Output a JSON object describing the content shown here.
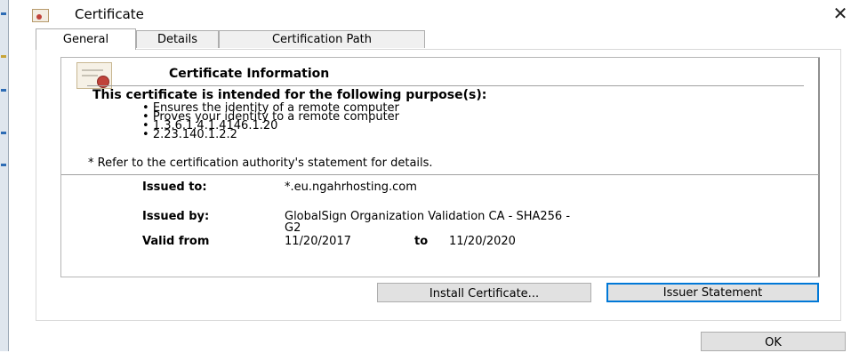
{
  "window": {
    "title": "Certificate",
    "close_glyph": "✕"
  },
  "tabs": [
    {
      "label": "General",
      "active": true
    },
    {
      "label": "Details",
      "active": false
    },
    {
      "label": "Certification Path",
      "active": false
    }
  ],
  "info": {
    "heading": "Certificate Information",
    "purpose_heading": "This certificate is intended for the following purpose(s):",
    "purposes": [
      "Ensures the identity of a remote computer",
      "Proves your identity to a remote computer",
      "1.3.6.1.4.1.4146.1.20",
      "2.23.140.1.2.2"
    ],
    "note": "* Refer to the certification authority's statement for details."
  },
  "fields": {
    "issued_to_label": "Issued to:",
    "issued_to_value": "*.eu.ngahrhosting.com",
    "issued_by_label": "Issued by:",
    "issued_by_value_line1": "GlobalSign Organization Validation CA - SHA256 -",
    "issued_by_value_line2": "G2",
    "valid_from_label": "Valid from",
    "valid_from_value": "11/20/2017",
    "valid_to_label": "to",
    "valid_to_value": "11/20/2020"
  },
  "buttons": {
    "install": "Install Certificate...",
    "issuer": "Issuer Statement",
    "ok": "OK"
  },
  "icons": {
    "window": "certificate-icon",
    "info": "certificate-icon",
    "close": "close-icon"
  }
}
